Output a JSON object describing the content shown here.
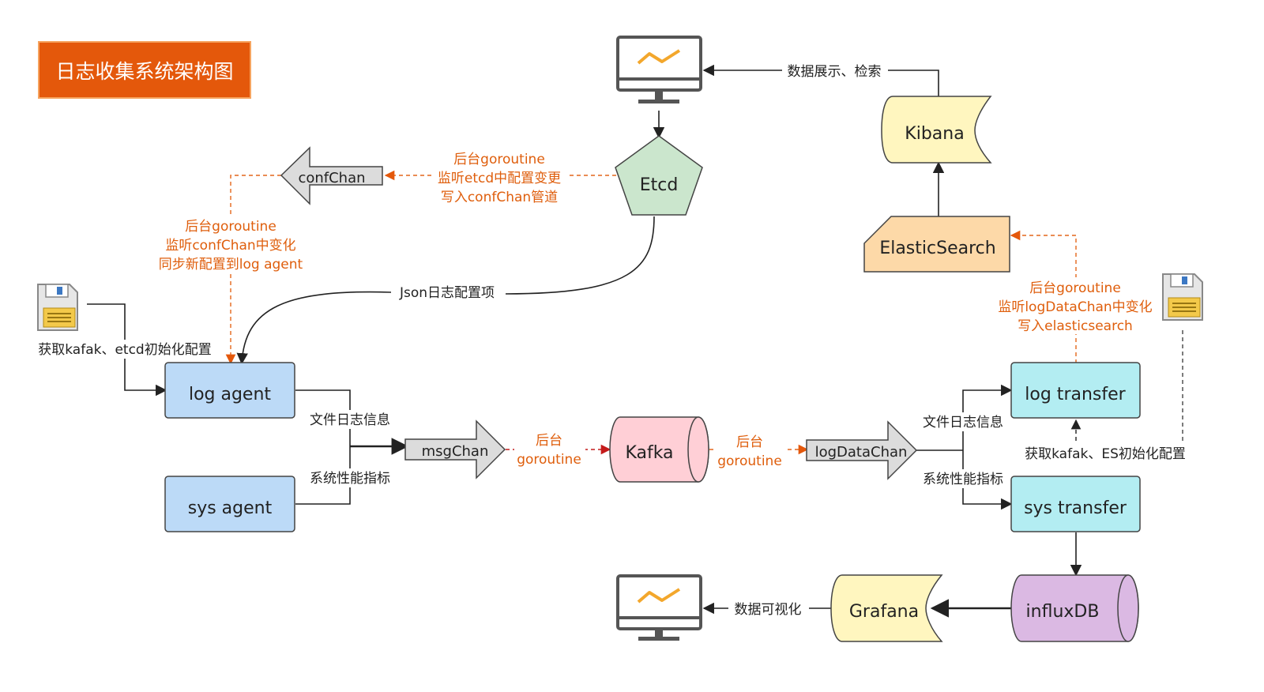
{
  "title": "日志收集系统架构图",
  "nodes": {
    "log_agent": "log agent",
    "sys_agent": "sys agent",
    "msgChan": "msgChan",
    "kafka": "Kafka",
    "logDataChan": "logDataChan",
    "log_transfer": "log transfer",
    "sys_transfer": "sys transfer",
    "influxdb": "influxDB",
    "grafana": "Grafana",
    "elasticsearch": "ElasticSearch",
    "kibana": "Kibana",
    "etcd": "Etcd",
    "confChan": "confChan"
  },
  "labels": {
    "show_search": "数据展示、检索",
    "visualize": "数据可视化",
    "json_config": "Json日志配置项",
    "agent_init": "获取kafak、etcd初始化配置",
    "transfer_init": "获取kafak、ES初始化配置",
    "file_log_left": "文件日志信息",
    "sys_metrics_left": "系统性能指标",
    "file_log_right": "文件日志信息",
    "sys_metrics_right": "系统性能指标",
    "bg_left_1": "后台",
    "bg_left_2": "goroutine",
    "bg_right_1": "后台",
    "bg_right_2": "goroutine",
    "etcd_watch_1": "后台goroutine",
    "etcd_watch_2": "监听etcd中配置变更",
    "etcd_watch_3": "写入confChan管道",
    "conf_watch_1": "后台goroutine",
    "conf_watch_2": "监听confChan中变化",
    "conf_watch_3": "同步新配置到log agent",
    "es_write_1": "后台goroutine",
    "es_write_2": "监听logDataChan中变化",
    "es_write_3": "写入elasticsearch"
  },
  "colors": {
    "title_bg": "#e4580b",
    "agent_fill": "#bcdaf7",
    "transfer_fill": "#b3edf2",
    "kafka_fill": "#ffcfd6",
    "influx_fill": "#dbb9e3",
    "grafana_fill": "#fff6bf",
    "kibana_fill": "#fff6bf",
    "es_fill": "#fdd9a8",
    "etcd_fill": "#cbe6cd",
    "chan_fill": "#dcdcdc",
    "orange_text": "#df5e0c",
    "dashed_orange": "#e4671b"
  },
  "icons": [
    "monitor-icon",
    "floppy-disk-icon"
  ]
}
